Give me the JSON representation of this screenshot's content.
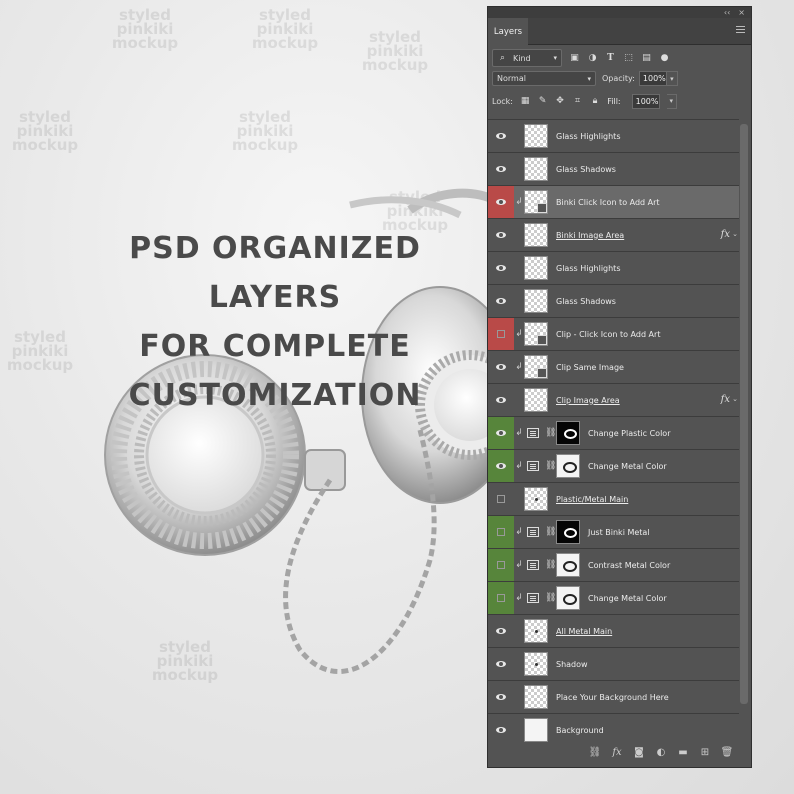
{
  "headline": {
    "line1": "PSD ORGANIZED LAYERS",
    "line2": "FOR COMPLETE",
    "line3": "CUSTOMIZATION"
  },
  "watermark": "styled\npinkiki\nmockup",
  "panel": {
    "tab_label": "Layers",
    "filter_kind": "Kind",
    "blend_mode": "Normal",
    "opacity_label": "Opacity:",
    "opacity_value": "100%",
    "lock_label": "Lock:",
    "fill_label": "Fill:",
    "fill_value": "100%"
  },
  "layers": [
    {
      "name": "Glass Highlights",
      "vis": "eye",
      "thumb": "checker"
    },
    {
      "name": "Glass Shadows",
      "vis": "eye",
      "thumb": "checker"
    },
    {
      "name": "Binki Click Icon to Add Art",
      "vis": "red-eye",
      "thumb": "smart",
      "clip": true,
      "selected": true
    },
    {
      "name": "Binki Image Area",
      "vis": "eye",
      "thumb": "checker",
      "underline": true,
      "fx": true
    },
    {
      "name": "Glass Highlights",
      "vis": "eye",
      "thumb": "checker"
    },
    {
      "name": "Glass Shadows",
      "vis": "eye",
      "thumb": "checker"
    },
    {
      "name": "Clip - Click Icon to Add Art",
      "vis": "red-box",
      "thumb": "smart",
      "clip": true
    },
    {
      "name": "Clip Same Image",
      "vis": "eye",
      "thumb": "smart",
      "clip": true
    },
    {
      "name": "Clip Image Area",
      "vis": "eye",
      "thumb": "checker",
      "underline": true,
      "fx": true
    },
    {
      "name": "Change Plastic Color",
      "vis": "green-eye",
      "adjust": true,
      "mask": "black",
      "clip": true
    },
    {
      "name": "Change Metal Color",
      "vis": "green-eye",
      "adjust": true,
      "mask": "white",
      "clip": true
    },
    {
      "name": "Plastic/Metal Main",
      "vis": "box",
      "thumb": "dot",
      "underline": true
    },
    {
      "name": "Just Binki Metal",
      "vis": "green-box",
      "adjust": true,
      "mask": "black",
      "clip": true
    },
    {
      "name": "Contrast Metal Color",
      "vis": "green-box",
      "adjust": true,
      "mask": "white",
      "clip": true
    },
    {
      "name": "Change Metal Color",
      "vis": "green-box",
      "adjust": true,
      "mask": "white",
      "clip": true
    },
    {
      "name": "All Metal Main",
      "vis": "eye",
      "thumb": "dot",
      "underline": true
    },
    {
      "name": "Shadow",
      "vis": "eye",
      "thumb": "dot"
    },
    {
      "name": "Place Your Background Here",
      "vis": "eye",
      "thumb": "checker"
    },
    {
      "name": "Background",
      "vis": "eye",
      "thumb": "white"
    }
  ],
  "icons": {
    "filter": [
      "image-filter-icon",
      "adjustment-filter-icon",
      "type-filter-icon",
      "shape-filter-icon",
      "smart-object-filter-icon"
    ],
    "lock": [
      "lock-transparent-icon",
      "lock-image-icon",
      "lock-position-icon",
      "lock-artboard-icon",
      "lock-all-icon"
    ],
    "bottom": [
      "link-layers-icon",
      "fx-icon",
      "add-mask-icon",
      "new-adjustment-icon",
      "new-group-icon",
      "new-layer-icon",
      "delete-layer-icon"
    ]
  },
  "colors": {
    "panel_bg": "#535353",
    "hidden_red": "#b94a48",
    "hidden_green": "#57853b",
    "selected": "#6a6a6a"
  }
}
